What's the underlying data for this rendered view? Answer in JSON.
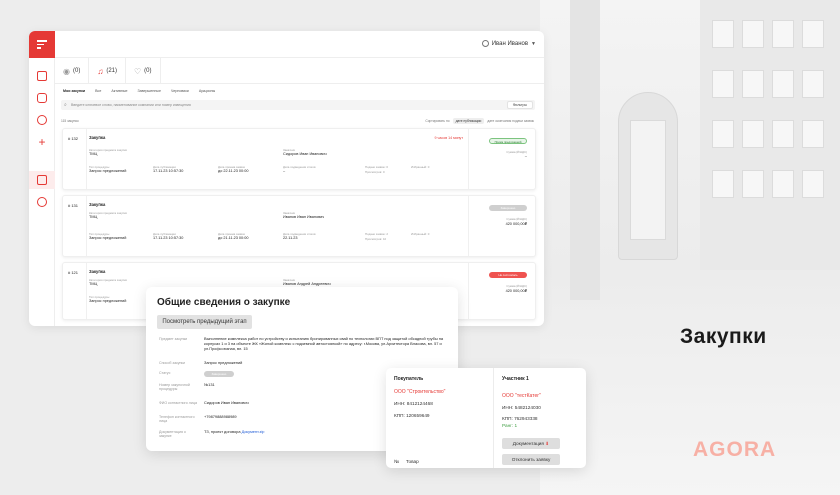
{
  "user": {
    "name": "Иван Иванов"
  },
  "tabs": [
    {
      "icon": "eye-icon",
      "label": "(0)"
    },
    {
      "icon": "bell-icon",
      "label": "(21)"
    },
    {
      "icon": "heart-icon",
      "label": "(0)"
    }
  ],
  "filters": [
    "Мои закупки",
    "Все",
    "Активные",
    "Завершенные",
    "Черновики",
    "Аукционы"
  ],
  "search": {
    "placeholder": "Введите ключевое слово, наименование компании или номер извещения",
    "filter_button": "Фильтры"
  },
  "list": {
    "found": "115 закупок",
    "sort_label": "Сортировать по",
    "sort_value": "дате публикации",
    "sort_alt": "дате окончания подачи заявок"
  },
  "cards": [
    {
      "num": "# 132",
      "type": "Закупка",
      "timer": "9 часов 14 минут",
      "status": "Прием предложений",
      "category_label": "Категория предмета закупки",
      "category": "ТМЦ",
      "customer_label": "Заказчик",
      "customer": "Сидоров Иван Иванович",
      "proc_label": "Тип процедуры",
      "proc": "Запрос предложений",
      "pub_label": "Дата публикации",
      "pub": "17.11.23 10:57:30",
      "deadline_label": "Дата приема заявок",
      "deadline": "до 22.11.23 00:00",
      "result_label": "Дата подведения итогов",
      "result": "–",
      "bids_label": "Подано заявок: 0",
      "views_label": "Просмотров: 0",
      "fav_label": "Избранный: 0",
      "price_label": "Сумма (₽/НДС)",
      "price": "–"
    },
    {
      "num": "# 131",
      "type": "Закупка",
      "timer": "",
      "status": "Завершено",
      "category_label": "Категория предмета закупки",
      "category": "ТМЦ",
      "customer_label": "Заказчик",
      "customer": "Иванов Иван Иванович",
      "proc_label": "Тип процедуры",
      "proc": "Запрос предложений",
      "pub_label": "Дата публикации",
      "pub": "17.11.23 10:57:30",
      "deadline_label": "Дата приема заявок",
      "deadline": "до 21.11.23 00:00",
      "result_label": "Дата подведения итогов",
      "result": "22.11.23",
      "bids_label": "Подано заявок: 2",
      "views_label": "Просмотров: 10",
      "fav_label": "Избранный: 0",
      "price_label": "Сумма (₽/НДС)",
      "price": "420 000,00₽"
    },
    {
      "num": "# 121",
      "type": "Закупка",
      "timer": "",
      "status": "Не состоялась",
      "category_label": "Категория предмета закупки",
      "category": "ТМЦ",
      "customer_label": "Заказчик",
      "customer": "Иванов Андрей Андреевич",
      "proc_label": "Тип процедуры",
      "proc": "Запрос предложений",
      "price_label": "Сумма (₽/НДС)",
      "price": "420 000,00₽"
    }
  ],
  "general": {
    "title": "Общие сведения о закупке",
    "prev_button": "Посмотреть предыдущий этап",
    "subject_label": "Предмет закупки",
    "subject": "Выполнение комплекса работ по устройству и испытанию бронированных свай по технологии ВПТ под защитой обсадной трубы на корпусах 1 и 3 на объекте ЖК «Жилой комплекс с подземной автостоянкой» по адресу: г.Москва, ул.Архитектора Власова, вл. 57 и ул.Профсоюзная, вл. 15",
    "method_label": "Способ закупки",
    "method": "Запрос предложений",
    "status_label": "Статус",
    "status": "Завершено",
    "number_label": "Номер закупочной процедуры",
    "number": "№131",
    "contact_label": "ФИО контактного лица",
    "contact": "Сидоров Иван Иванович",
    "phone_label": "Телефон контактного лица",
    "phone": "+79879888988989",
    "docs_label": "Документация о закупке",
    "docs_prefix": "ТЗ, проект договора",
    "docs_link": "Документ.zip"
  },
  "compare": {
    "buyer_title": "Покупатель",
    "buyer_name": "ООО \"Строительство\"",
    "buyer_inn": "ИНН: 8412124468",
    "buyer_kpp": "КПП: 120659649",
    "item_no": "№",
    "item_label": "Товар",
    "participant_title": "Участник 1",
    "participant_name": "ООО \"тестКатег\"",
    "participant_inn": "ИНН: 5482124030",
    "participant_kpp": "КПП: 762943338",
    "participant_rank": "Ранг: 1",
    "docs_button": "Документация",
    "reject_button": "Отклонить заявку"
  },
  "headline": "Закупки",
  "brand": "AGORA",
  "colors": {
    "accent": "#e53935",
    "brand_pale": "#f7b0a5",
    "link": "#1e5bd6",
    "success": "#43a047"
  }
}
